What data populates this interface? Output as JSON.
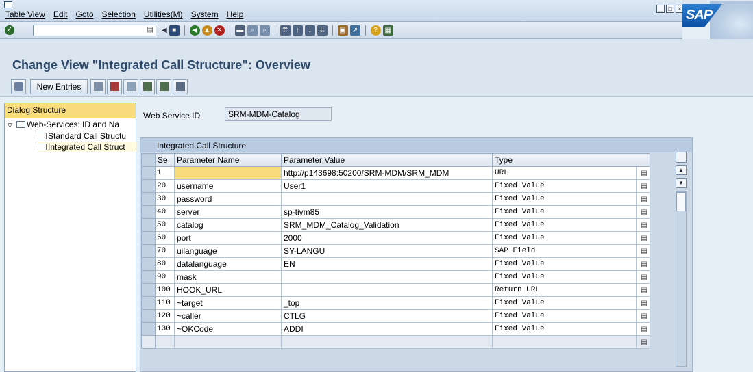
{
  "menu": [
    "Table View",
    "Edit",
    "Goto",
    "Selection",
    "Utilities(M)",
    "System",
    "Help"
  ],
  "window_buttons": [
    "minimize",
    "maximize",
    "close"
  ],
  "logo": "SAP",
  "command_field": {
    "value": ""
  },
  "page_title": "Change View \"Integrated Call Structure\": Overview",
  "app_toolbar": {
    "new_entries_label": "New Entries"
  },
  "dialog_structure": {
    "header": "Dialog Structure",
    "items": [
      {
        "label": "Web-Services: ID and Na",
        "level": 0,
        "expanded": true
      },
      {
        "label": "Standard Call Structu",
        "level": 1
      },
      {
        "label": "Integrated Call Struct",
        "level": 1,
        "selected": true
      }
    ]
  },
  "web_service": {
    "label": "Web Service ID",
    "value": "SRM-MDM-Catalog"
  },
  "table": {
    "caption": "Integrated Call Structure",
    "columns": [
      "Se",
      "Parameter Name",
      "Parameter Value",
      "Type"
    ],
    "rows": [
      {
        "seq": "1",
        "name": "",
        "value": "http://p143698:50200/SRM-MDM/SRM_MDM",
        "type": "URL"
      },
      {
        "seq": "20",
        "name": "username",
        "value": "User1",
        "type": "Fixed Value"
      },
      {
        "seq": "30",
        "name": "password",
        "value": "",
        "type": "Fixed Value"
      },
      {
        "seq": "40",
        "name": "server",
        "value": "sp-tivm85",
        "type": "Fixed Value"
      },
      {
        "seq": "50",
        "name": "catalog",
        "value": "SRM_MDM_Catalog_Validation",
        "type": "Fixed Value"
      },
      {
        "seq": "60",
        "name": "port",
        "value": "2000",
        "type": "Fixed Value"
      },
      {
        "seq": "70",
        "name": "uilanguage",
        "value": "SY-LANGU",
        "type": "SAP Field"
      },
      {
        "seq": "80",
        "name": "datalanguage",
        "value": "EN",
        "type": "Fixed Value"
      },
      {
        "seq": "90",
        "name": "mask",
        "value": "",
        "type": "Fixed Value"
      },
      {
        "seq": "100",
        "name": "HOOK_URL",
        "value": "",
        "type": "Return URL"
      },
      {
        "seq": "110",
        "name": "~target",
        "value": "_top",
        "type": "Fixed Value"
      },
      {
        "seq": "120",
        "name": "~caller",
        "value": "CTLG",
        "type": "Fixed Value"
      },
      {
        "seq": "130",
        "name": "~OKCode",
        "value": "ADDI",
        "type": "Fixed Value"
      }
    ]
  },
  "colors": {
    "title": "#2e4a6a",
    "tree_header": "#f9dd7c",
    "frame": "#ccd8e6"
  }
}
